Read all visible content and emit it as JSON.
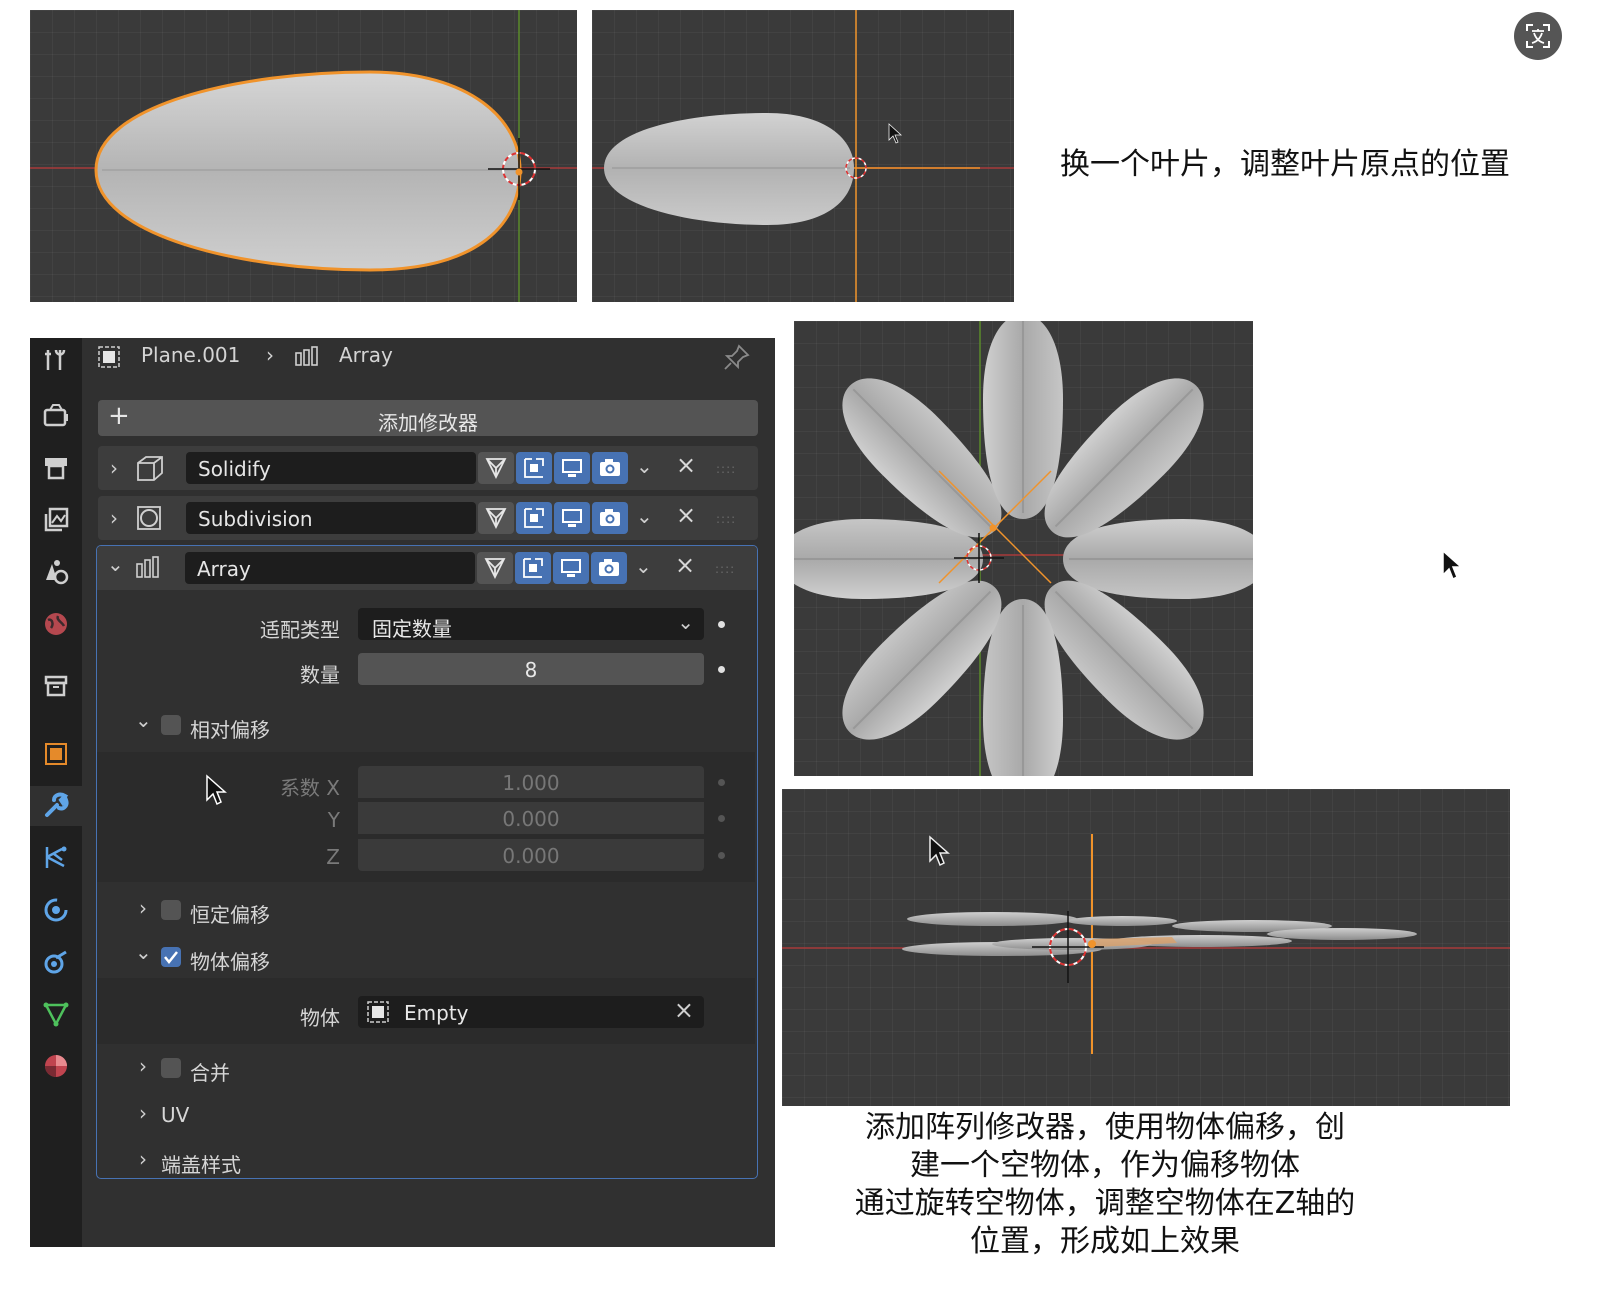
{
  "captions": {
    "top_right": "换一个叶片，调整叶片原点的位置",
    "bottom": [
      "添加阵列修改器，使用物体偏移，创",
      "建一个空物体，作为偏移物体",
      "通过旋转空物体，调整空物体在Z轴的",
      "位置，形成如上效果"
    ]
  },
  "corner_icon": "translate-icon",
  "panel": {
    "header": {
      "object_name": "Plane.001",
      "modifier_name": "Array"
    },
    "add_modifier_label": "添加修改器",
    "modifiers": [
      {
        "name": "Solidify"
      },
      {
        "name": "Subdivision"
      },
      {
        "name": "Array"
      }
    ],
    "array": {
      "fit_type_label": "适配类型",
      "fit_type_value": "固定数量",
      "count_label": "数量",
      "count_value": "8",
      "relative_offset": {
        "label": "相对偏移",
        "factor_x_label": "系数 X",
        "factor_x": "1.000",
        "y_label": "Y",
        "y": "0.000",
        "z_label": "Z",
        "z": "0.000"
      },
      "constant_offset_label": "恒定偏移",
      "object_offset_label": "物体偏移",
      "object_label": "物体",
      "object_value": "Empty",
      "merge_label": "合并",
      "uv_label": "UV",
      "caps_label": "端盖样式"
    }
  },
  "colors": {
    "accent_blue": "#4772b3",
    "selection_orange": "#f0932b",
    "axis_red": "#a83a3a",
    "axis_green": "#5a8a2a"
  }
}
